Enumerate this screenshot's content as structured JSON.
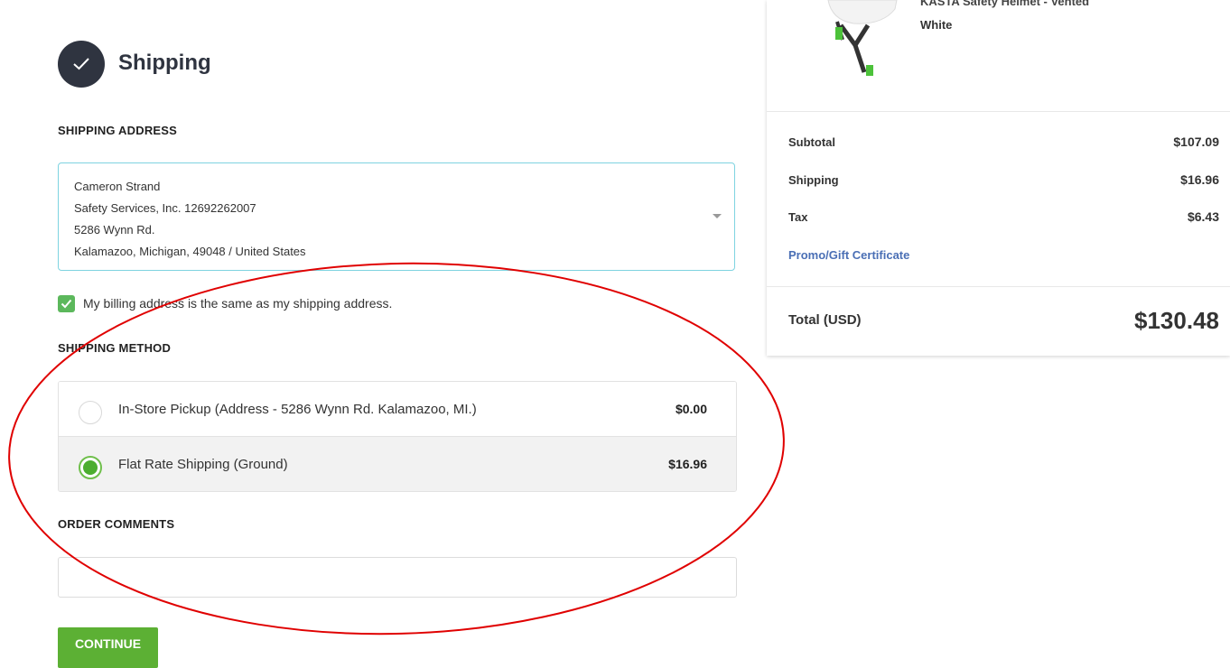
{
  "shipping": {
    "title": "Shipping",
    "address_label": "SHIPPING ADDRESS",
    "address_lines": [
      "Cameron Strand",
      "Safety Services, Inc. 12692262007",
      "5286 Wynn Rd.",
      "Kalamazoo, Michigan, 49048 / United States"
    ],
    "billing_same_label": "My billing address is the same as my shipping address.",
    "billing_same_checked": true,
    "method_label": "SHIPPING METHOD",
    "methods": [
      {
        "label": "In-Store Pickup (Address - 5286 Wynn Rd. Kalamazoo, MI.)",
        "price": "$0.00",
        "selected": false
      },
      {
        "label": "Flat Rate Shipping (Ground)",
        "price": "$16.96",
        "selected": true
      }
    ],
    "comments_label": "ORDER COMMENTS",
    "comments_value": "",
    "continue_label": "CONTINUE"
  },
  "summary": {
    "product_name": "KASTA Safety Helmet - Vented",
    "product_variant": "White",
    "subtotal_label": "Subtotal",
    "subtotal_value": "$107.09",
    "shipping_label": "Shipping",
    "shipping_value": "$16.96",
    "tax_label": "Tax",
    "tax_value": "$6.43",
    "promo_label": "Promo/Gift Certificate",
    "total_label": "Total (USD)",
    "total_value": "$130.48"
  },
  "colors": {
    "accent_green": "#5cb034",
    "dark_circle": "#2f3440",
    "link_blue": "#4a6fb5",
    "annotation_red": "#e00000"
  },
  "icons": {
    "step": "checkmark-icon",
    "select": "caret-down-icon",
    "checkbox": "checkmark-icon"
  }
}
